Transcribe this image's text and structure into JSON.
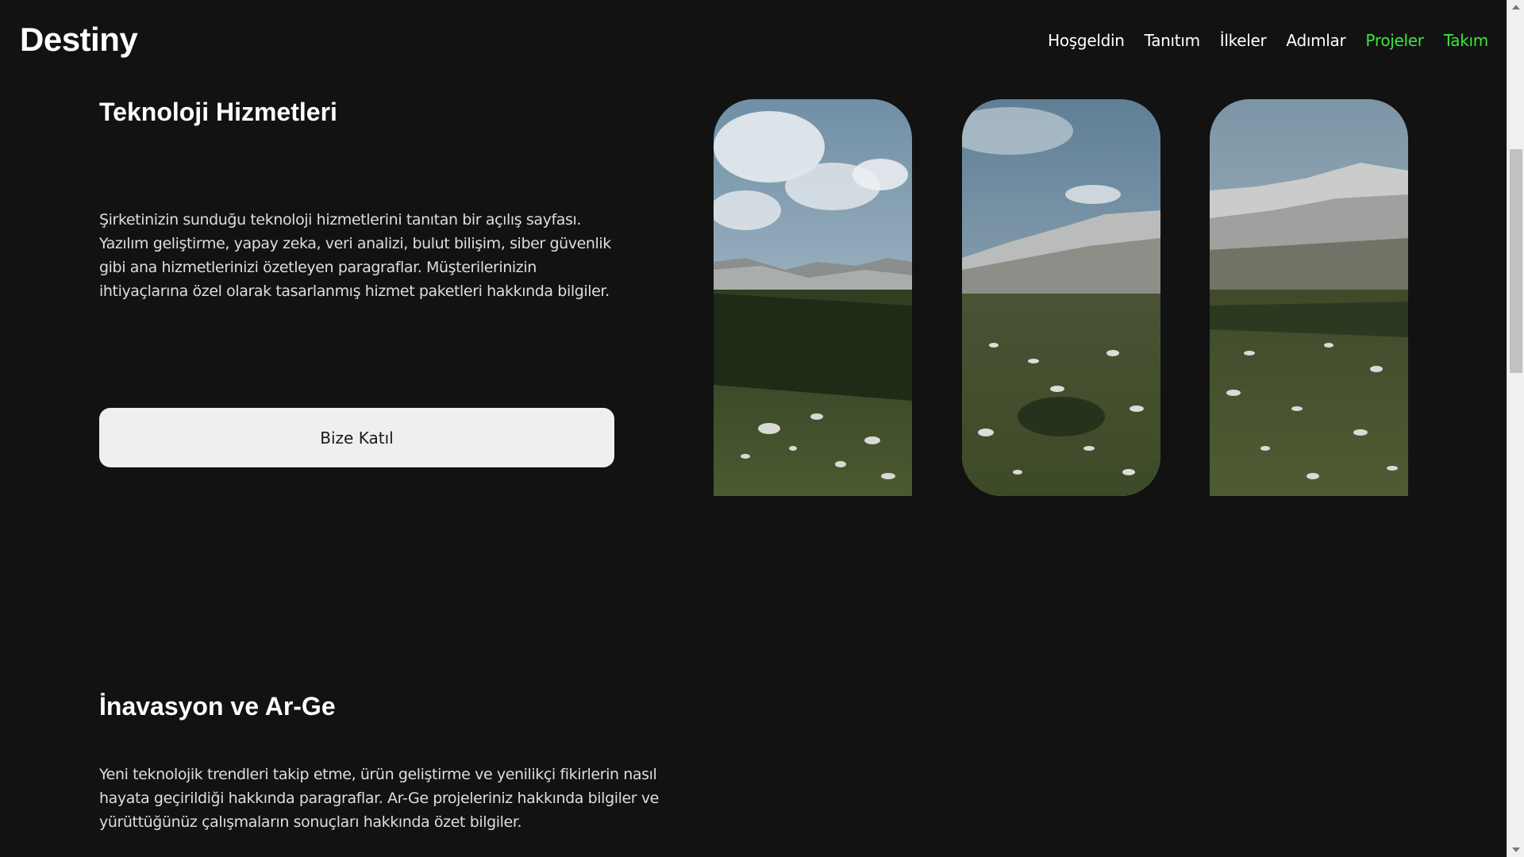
{
  "brand": {
    "name": "Destiny"
  },
  "nav": {
    "items": [
      {
        "label": "Hoşgeldin"
      },
      {
        "label": "Tanıtım"
      },
      {
        "label": "İlkeler"
      },
      {
        "label": "Adımlar"
      },
      {
        "label": "Projeler"
      },
      {
        "label": "Takım"
      }
    ],
    "active_color": "#3de63d"
  },
  "section_services": {
    "title": "Teknoloji Hizmetleri",
    "paragraph": "Şirketinizin sunduğu teknoloji hizmetlerini tanıtan bir açılış sayfası. Yazılım geliştirme, yapay zeka, veri analizi, bulut bilişim, siber güvenlik gibi ana hizmetlerinizi özetleyen paragraflar. Müşterilerinizin ihtiyaçlarına özel olarak tasarlanmış hizmet paketleri hakkında bilgiler.",
    "cta_label": "Bize Katıl"
  },
  "section_innovation": {
    "title": "İnavasyon ve Ar-Ge",
    "paragraph": "Yeni teknolojik trendleri takip etme, ürün geliştirme ve yenilikçi fikirlerin nasıl hayata geçirildiği hakkında paragraflar. Ar-Ge projeleriniz hakkında bilgiler ve yürüttüğünüz çalışmaların sonuçları hakkında özet bilgiler."
  },
  "images": [
    {
      "subject": "mountain-meadow-photo"
    },
    {
      "subject": "mountain-meadow-photo"
    },
    {
      "subject": "mountain-meadow-photo"
    }
  ],
  "colors": {
    "background": "#121212",
    "text": "#ffffff",
    "button_bg": "#efefef"
  }
}
